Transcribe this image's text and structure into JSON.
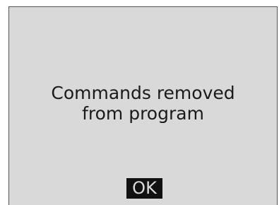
{
  "dialog": {
    "message_line1": "Commands removed",
    "message_line2": "from program",
    "ok_label": "OK"
  }
}
